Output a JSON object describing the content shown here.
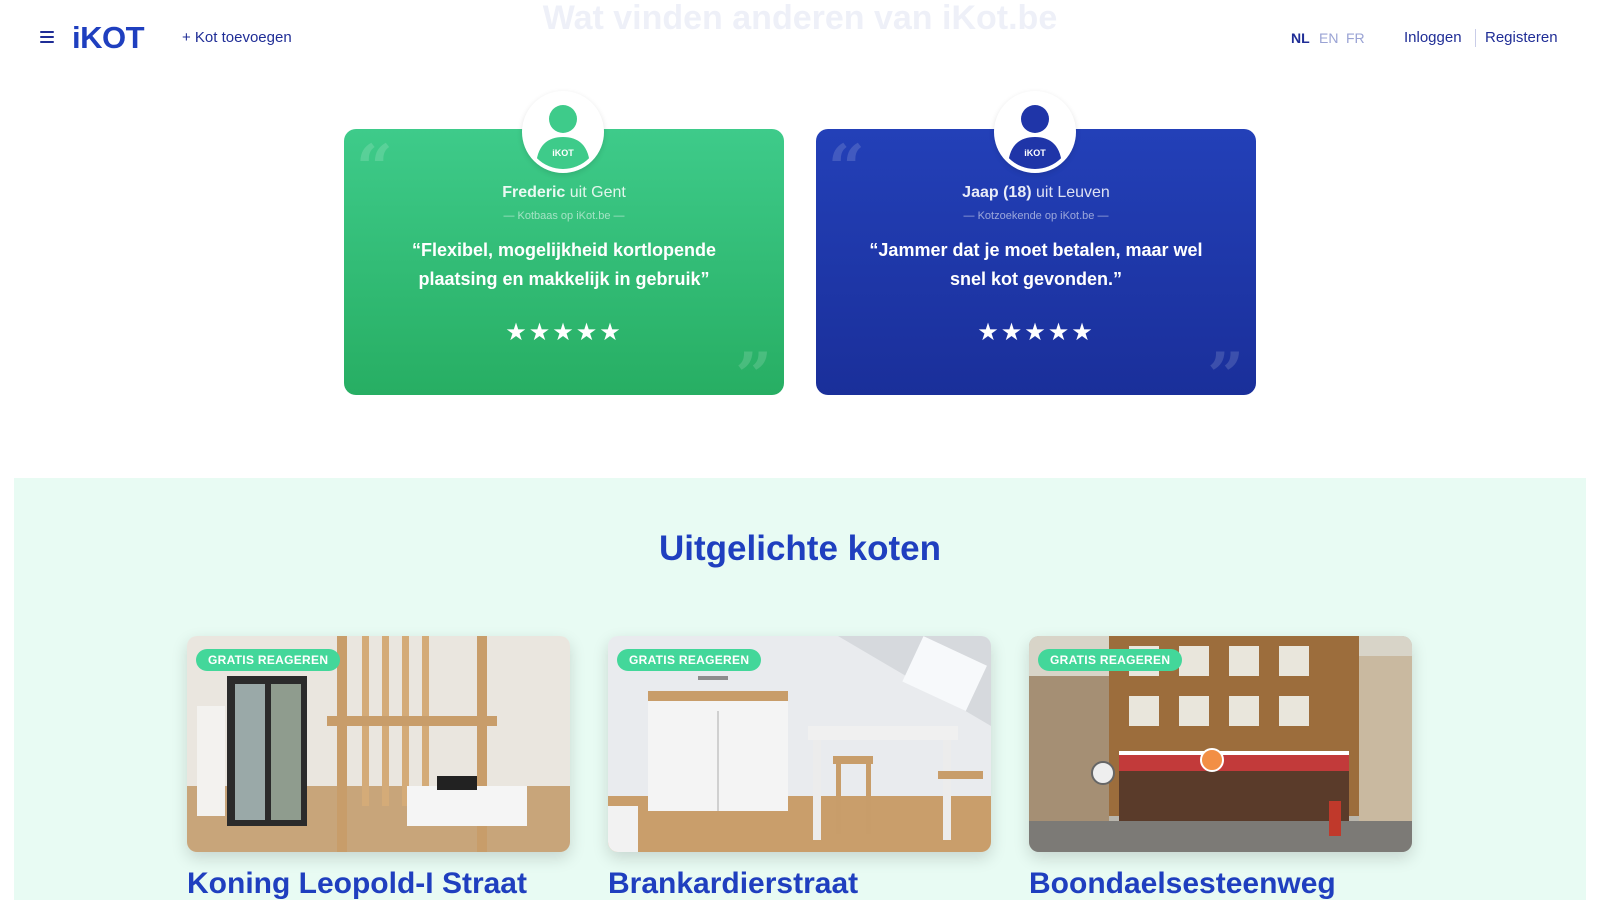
{
  "header": {
    "faded_title": "Wat vinden anderen van iKot.be",
    "logo": "iKOT",
    "add_link": "+ Kot toevoegen",
    "languages": [
      "NL",
      "EN",
      "FR"
    ],
    "active_language": "NL",
    "login": "Inloggen",
    "register": "Registeren",
    "menu_icon": "hamburger-icon"
  },
  "testimonials": [
    {
      "name": "Frederic",
      "city_text": " uit Gent",
      "role": "— Kotbaas op iKot.be —",
      "quote": "“Flexibel, mogelijkheid kortlopende plaatsing en makkelijk in gebruik”",
      "stars": "★★★★★",
      "rating": 5,
      "color": "#34c07a",
      "avatar_label": "iKOT"
    },
    {
      "name": "Jaap (18)",
      "city_text": " uit Leuven",
      "role": "— Kotzoekende op iKot.be —",
      "quote": "“Jammer dat je moet betalen, maar wel snel kot gevonden.”",
      "stars": "★★★★★",
      "rating": 5,
      "color": "#1f35a8",
      "avatar_label": "iKOT"
    }
  ],
  "quote_marks": {
    "open": "“",
    "close": "”"
  },
  "featured": {
    "title": "Uitgelichte koten",
    "background": "#e8fbf3",
    "listings": [
      {
        "badge": "GRATIS REAGEREN",
        "title": "Koning Leopold-I Straat",
        "image": "bedroom-loft-photo"
      },
      {
        "badge": "GRATIS REAGEREN",
        "title": "Brankardierstraat",
        "image": "kitchenette-photo"
      },
      {
        "badge": "GRATIS REAGEREN",
        "title": "Boondaelsesteenweg",
        "image": "street-view-photo"
      }
    ]
  },
  "colors": {
    "brand_blue": "#1f3fbf",
    "brand_green": "#43d79a",
    "text_dark": "#1f2d96"
  }
}
